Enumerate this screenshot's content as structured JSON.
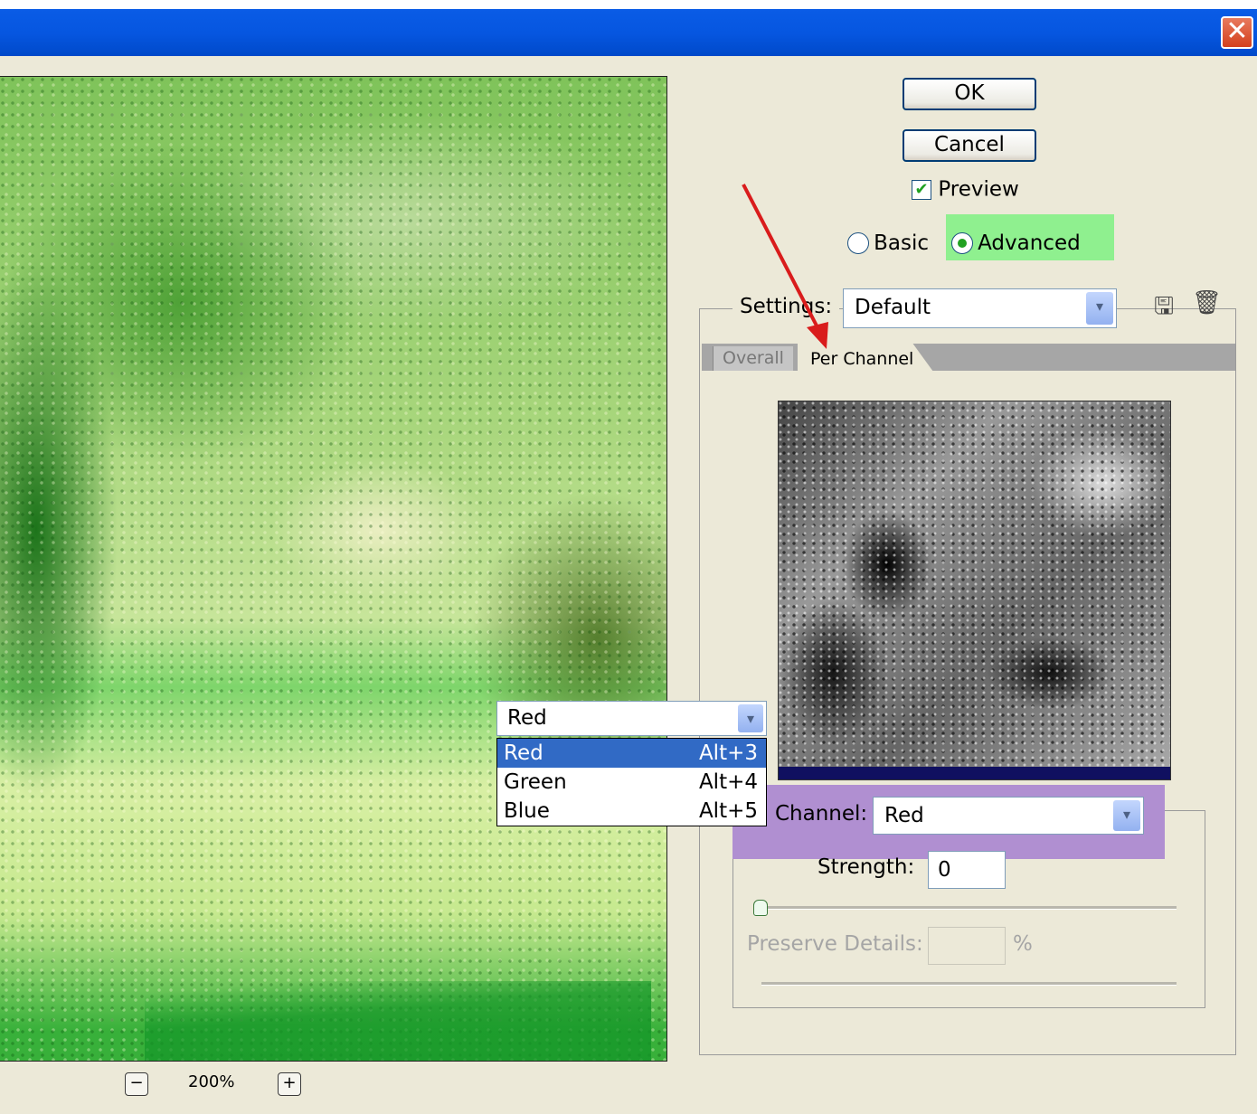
{
  "window": {
    "close_glyph": "✕"
  },
  "preview": {
    "zoom_label": "200%",
    "zoom_out_glyph": "−",
    "zoom_in_glyph": "+"
  },
  "buttons": {
    "ok": "OK",
    "cancel": "Cancel"
  },
  "preview_checkbox": {
    "label": "Preview",
    "checked": true,
    "check_glyph": "✔"
  },
  "mode": {
    "basic": "Basic",
    "advanced": "Advanced",
    "selected": "Advanced"
  },
  "settings": {
    "label": "Settings:",
    "value": "Default",
    "save_icon": "save-settings-icon",
    "delete_icon": "trash-icon",
    "save_glyph": "🖫",
    "delete_glyph": "🗑"
  },
  "tabs": [
    {
      "label": "Overall",
      "active": false
    },
    {
      "label": "Per Channel",
      "active": true
    }
  ],
  "channel": {
    "label": "Channel:",
    "value": "Red",
    "dropdown_value": "Red",
    "options": [
      {
        "label": "Red",
        "shortcut": "Alt+3",
        "selected": true
      },
      {
        "label": "Green",
        "shortcut": "Alt+4",
        "selected": false
      },
      {
        "label": "Blue",
        "shortcut": "Alt+5",
        "selected": false
      }
    ]
  },
  "strength": {
    "label": "Strength:",
    "value": "0"
  },
  "preserve_details": {
    "label": "Preserve Details:",
    "value": "",
    "unit": "%",
    "disabled": true
  },
  "colors": {
    "titlebar": "#0656e0",
    "highlight_advanced": "#8ff08f",
    "highlight_channel": "#b08fd1",
    "arrow": "#d91c1c",
    "selection": "#316ac5"
  },
  "arrow_glyph": "▾"
}
